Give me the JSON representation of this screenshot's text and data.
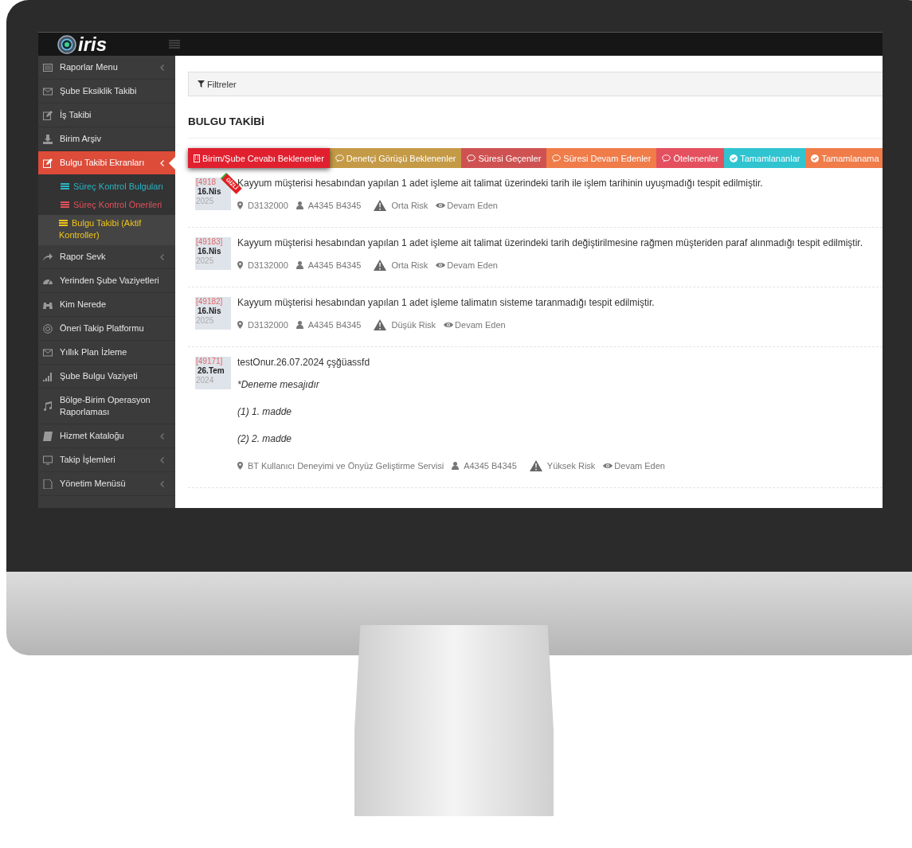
{
  "logo": {
    "text": "iris"
  },
  "sidebar": {
    "items": [
      {
        "label": "Raporlar Menu",
        "expandable": true,
        "selected": false
      },
      {
        "label": "Şube Eksiklik Takibi",
        "expandable": false,
        "selected": false
      },
      {
        "label": "İş Takibi",
        "expandable": false,
        "selected": false
      },
      {
        "label": "Birim Arşiv",
        "expandable": false,
        "selected": false
      },
      {
        "label": "Bulgu Takibi Ekranları",
        "expandable": true,
        "selected": true,
        "children": [
          {
            "label": "Süreç Kontrol Bulguları",
            "color": "#2ab4c4",
            "selected": false
          },
          {
            "label": "Süreç Kontrol Önerileri",
            "color": "#e0505a",
            "selected": false
          },
          {
            "label": "Bulgu Takibi (Aktif Kontroller)",
            "color": "#f0c419",
            "selected": true
          }
        ]
      },
      {
        "label": "Rapor Sevk",
        "expandable": true,
        "selected": false
      },
      {
        "label": "Yerinden Şube Vaziyetleri",
        "expandable": false,
        "selected": false
      },
      {
        "label": "Kim Nerede",
        "expandable": false,
        "selected": false
      },
      {
        "label": "Öneri Takip Platformu",
        "expandable": false,
        "selected": false
      },
      {
        "label": "Yıllık Plan İzleme",
        "expandable": false,
        "selected": false
      },
      {
        "label": "Şube Bulgu Vaziyeti",
        "expandable": false,
        "selected": false
      },
      {
        "label": "Bölge-Birim Operasyon Raporlaması",
        "expandable": false,
        "selected": false
      },
      {
        "label": "Hizmet Kataloğu",
        "expandable": true,
        "selected": false
      },
      {
        "label": "Takip İşlemleri",
        "expandable": true,
        "selected": false
      },
      {
        "label": "Yönetim Menüsü",
        "expandable": true,
        "selected": false
      }
    ]
  },
  "filter_bar": {
    "label": "Filtreler"
  },
  "heading": "BULGU TAKİBİ",
  "tabs": [
    {
      "label": "Birim/Şube Cevabı Beklenenler",
      "color": "#e0202f",
      "selected": true
    },
    {
      "label": "Denetçi Görüşü Beklenenler",
      "color": "#c49a46",
      "selected": false
    },
    {
      "label": "Süresi Geçenler",
      "color": "#cf5252",
      "selected": false
    },
    {
      "label": "Süresi Devam Edenler",
      "color": "#f07c4a",
      "selected": false
    },
    {
      "label": "Ötelenenler",
      "color": "#e4505e",
      "selected": false
    },
    {
      "label": "Tamamlananlar",
      "color": "#30c4d0",
      "selected": false
    },
    {
      "label": "Tamamlanama",
      "color": "#f07c4a",
      "selected": false
    }
  ],
  "findings": [
    {
      "id": "[4918",
      "day": "16.Nis",
      "year": "2025",
      "badge": "GİZLİ",
      "paragraphs": [
        {
          "text": "Kayyum müşterisi hesabından yapılan 1 adet işleme ait talimat üzerindeki tarih ile işlem tarihinin uyuşmadığı tespit edilmiştir.",
          "italic": false
        }
      ],
      "location": "D3132000",
      "person": "A4345 B4345",
      "risk": "Orta Risk",
      "status": "Devam Eden"
    },
    {
      "id": "[49183]",
      "day": "16.Nis",
      "year": "2025",
      "paragraphs": [
        {
          "text": "Kayyum müşterisi hesabından yapılan 1 adet işleme ait talimat üzerindeki tarih değiştirilmesine rağmen müşteriden paraf alınmadığı tespit edilmiştir.",
          "italic": false
        }
      ],
      "location": "D3132000",
      "person": "A4345 B4345",
      "risk": "Orta Risk",
      "status": "Devam Eden"
    },
    {
      "id": "[49182]",
      "day": "16.Nis",
      "year": "2025",
      "paragraphs": [
        {
          "text": "Kayyum müşterisi hesabından yapılan 1 adet işleme talimatın sisteme taranmadığı tespit edilmiştir.",
          "italic": false
        }
      ],
      "location": "D3132000",
      "person": "A4345 B4345",
      "risk": "Düşük Risk",
      "status": "Devam Eden"
    },
    {
      "id": "[49171]",
      "day": "26.Tem",
      "year": "2024",
      "paragraphs": [
        {
          "text": "testOnur.26.07.2024    çşğüassfd",
          "italic": false
        },
        {
          "text": "*Deneme mesajıdır",
          "italic": true
        },
        {
          "text": "(1) 1. madde",
          "italic": true
        },
        {
          "text": "(2) 2. madde",
          "italic": true
        }
      ],
      "location": "BT Kullanıcı Deneyimi ve Önyüz Geliştirme Servisi",
      "person": "A4345 B4345",
      "risk": "Yüksek Risk",
      "status": "Devam Eden"
    }
  ]
}
